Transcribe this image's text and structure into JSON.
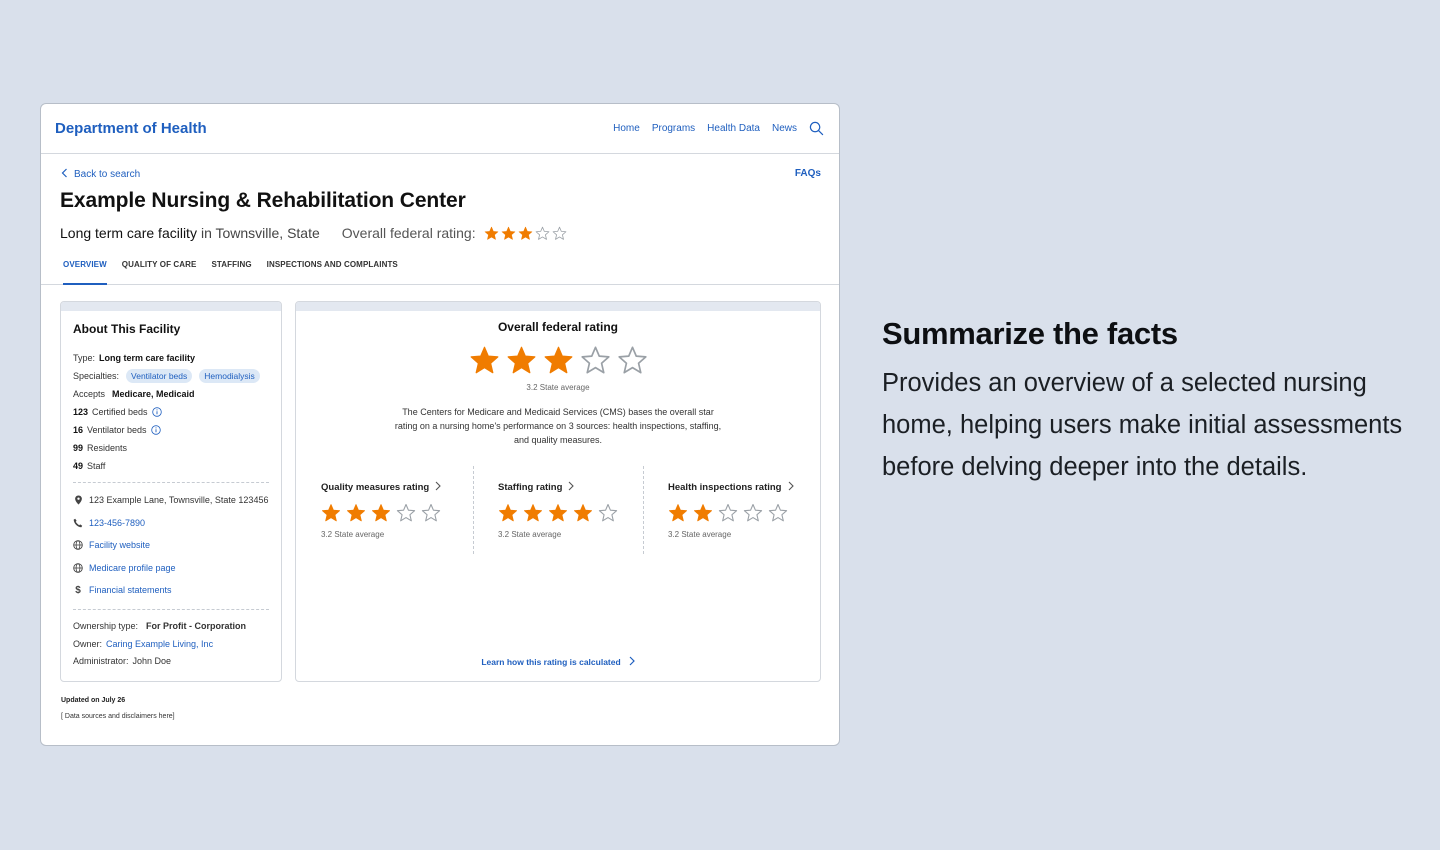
{
  "header": {
    "brand": "Department of Health",
    "nav": [
      "Home",
      "Programs",
      "Health Data",
      "News"
    ]
  },
  "page": {
    "back_label": "Back to search",
    "faqs_label": "FAQs",
    "title": "Example Nursing & Rehabilitation Center",
    "facility_type": "Long term care facility",
    "location": "in Townsville, State",
    "overall_label": "Overall federal rating:",
    "overall_stars": 3,
    "tabs": [
      "OVERVIEW",
      "QUALITY OF CARE",
      "STAFFING",
      "INSPECTIONS AND COMPLAINTS"
    ],
    "active_tab": 0
  },
  "about": {
    "title": "About This Facility",
    "type_label": "Type:",
    "type_value": "Long term care facility",
    "specialties_label": "Specialties:",
    "specialties": [
      "Ventilator beds",
      "Hemodialysis"
    ],
    "accepts_label": "Accepts",
    "accepts_value": "Medicare, Medicaid",
    "certified_beds_count": "123",
    "certified_beds_label": "Certified beds",
    "ventilator_beds_count": "16",
    "ventilator_beds_label": "Ventilator beds",
    "residents_count": "99",
    "residents_label": "Residents",
    "staff_count": "49",
    "staff_label": "Staff",
    "address": "123 Example Lane, Townsville, State 123456",
    "phone": "123-456-7890",
    "website_label": "Facility website",
    "medicare_label": "Medicare profile page",
    "financial_label": "Financial statements",
    "ownership_label": "Ownership type:",
    "ownership_value": "For Profit - Corporation",
    "owner_label": "Owner:",
    "owner_value": "Caring Example Living, Inc",
    "admin_label": "Administrator:",
    "admin_value": "John Doe"
  },
  "rating": {
    "title": "Overall federal rating",
    "stars": 3,
    "state_average": "3.2 State average",
    "description": "The Centers for Medicare and Medicaid Services (CMS) bases the overall star rating on a nursing home's performance on 3 sources: health inspections, staffing, and quality measures.",
    "subratings": [
      {
        "label": "Quality measures rating",
        "stars": 3,
        "average": "3.2 State average"
      },
      {
        "label": "Staffing rating",
        "stars": 4,
        "average": "3.2 State average"
      },
      {
        "label": "Health inspections rating",
        "stars": 2,
        "average": "3.2 State average"
      }
    ],
    "learn_label": "Learn how this rating is calculated"
  },
  "footer": {
    "updated": "Updated on July 26",
    "sources": "[ Data sources and disclaimers here]"
  },
  "side": {
    "heading": "Summarize the facts",
    "body": "Provides an overview of a selected nursing home, helping users make initial assessments before delving deeper into the details."
  },
  "colors": {
    "background": "#d9e0eb",
    "link": "#1f5fbf",
    "star_filled": "#f07c00",
    "star_empty": "#9aa0a6",
    "pill_bg": "#dce8f6"
  }
}
